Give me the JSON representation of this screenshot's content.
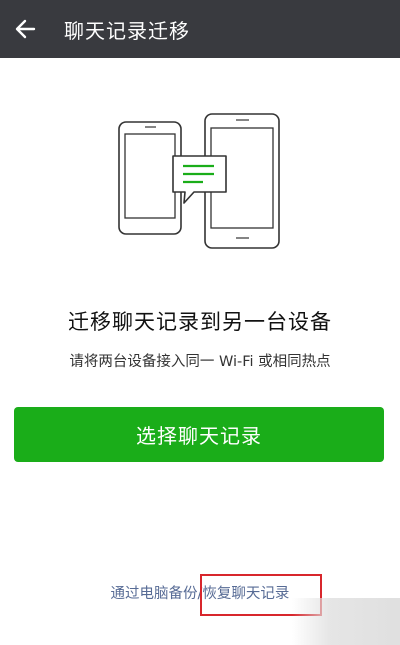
{
  "header": {
    "title": "聊天记录迁移",
    "back_icon": "arrow-left-icon"
  },
  "illustration": {
    "icon": "phones-transfer-icon",
    "accent_color": "#1aad19"
  },
  "main": {
    "heading": "迁移聊天记录到另一台设备",
    "subtext": "请将两台设备接入同一 Wi-Fi 或相同热点",
    "primary_button_label": "选择聊天记录"
  },
  "footer": {
    "link_text": "通过电脑备份/恢复聊天记录",
    "link_color": "#576b95"
  },
  "colors": {
    "header_bg": "#393a3f",
    "button_bg": "#1aad19"
  }
}
